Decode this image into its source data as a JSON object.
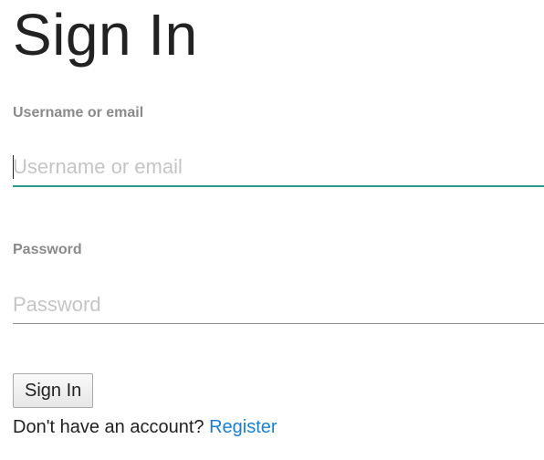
{
  "page": {
    "title": "Sign In"
  },
  "form": {
    "username": {
      "label": "Username or email",
      "placeholder": "Username or email",
      "value": "",
      "focused": true,
      "focus_color": "#2b9b8c"
    },
    "password": {
      "label": "Password",
      "placeholder": "Password",
      "value": ""
    },
    "submit_label": "Sign In"
  },
  "footer": {
    "prompt": "Don't have an account?",
    "register_link": "Register",
    "link_color": "#1a7fd4"
  }
}
